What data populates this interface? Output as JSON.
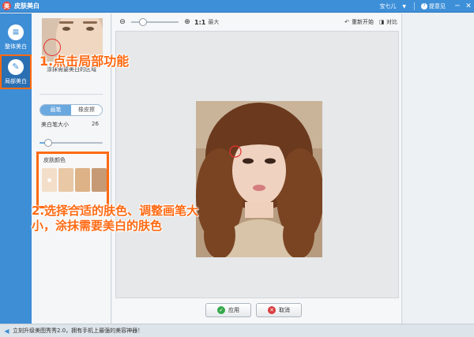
{
  "titlebar": {
    "logo_glyph": "美",
    "title": "皮肤美白",
    "user": "宝七儿",
    "user_caret": "▼",
    "feedback_icon": "?",
    "feedback": "提意见",
    "minimize": "─",
    "close": "✕"
  },
  "sidebar": {
    "items": [
      {
        "label": "整体美白",
        "icon": "menu-icon",
        "glyph": "≡"
      },
      {
        "label": "局部美白",
        "icon": "brush-icon",
        "glyph": "✎"
      }
    ]
  },
  "left_panel": {
    "hint": "涂抹需要美白的区域",
    "tabs": [
      "画笔",
      "橡皮擦"
    ],
    "active_tab": 0,
    "brush_size_label": "美白笔大小",
    "brush_size_value": "26",
    "brush_size_fraction": 0.14,
    "skin_color_title": "皮肤颜色",
    "skin_color_selected_glyph": "●",
    "skin_colors": [
      "#f3dfc9",
      "#e9c8a6",
      "#dcb286",
      "#c69a74"
    ],
    "selected_color": 0
  },
  "editor": {
    "zoom_out_glyph": "⊖",
    "zoom_in_glyph": "⊕",
    "zoom_fraction": 0.25,
    "zoom_label_11": "1:1",
    "zoom_label_max": "最大",
    "reset_glyph": "↶",
    "reset": "重新开始",
    "compare_glyph": "◨",
    "compare": "对比",
    "apply_glyph": "✓",
    "apply": "应用",
    "cancel_glyph": "✕",
    "cancel": "取消"
  },
  "status": {
    "icon": "speaker-icon",
    "glyph": "◀",
    "text": "立刻升级美图秀秀2.0，拥有手机上最强的美容神器！"
  },
  "annotations": {
    "step1": "1.点击局部功能",
    "step2": "2.选择合适的肤色、调整画笔大小，涂抹需要美白的肤色"
  },
  "colors": {
    "accent": "#3d8fd8",
    "highlight": "#ff6a13",
    "apply_icon": "#35a84a",
    "cancel_icon": "#d93b3b"
  }
}
